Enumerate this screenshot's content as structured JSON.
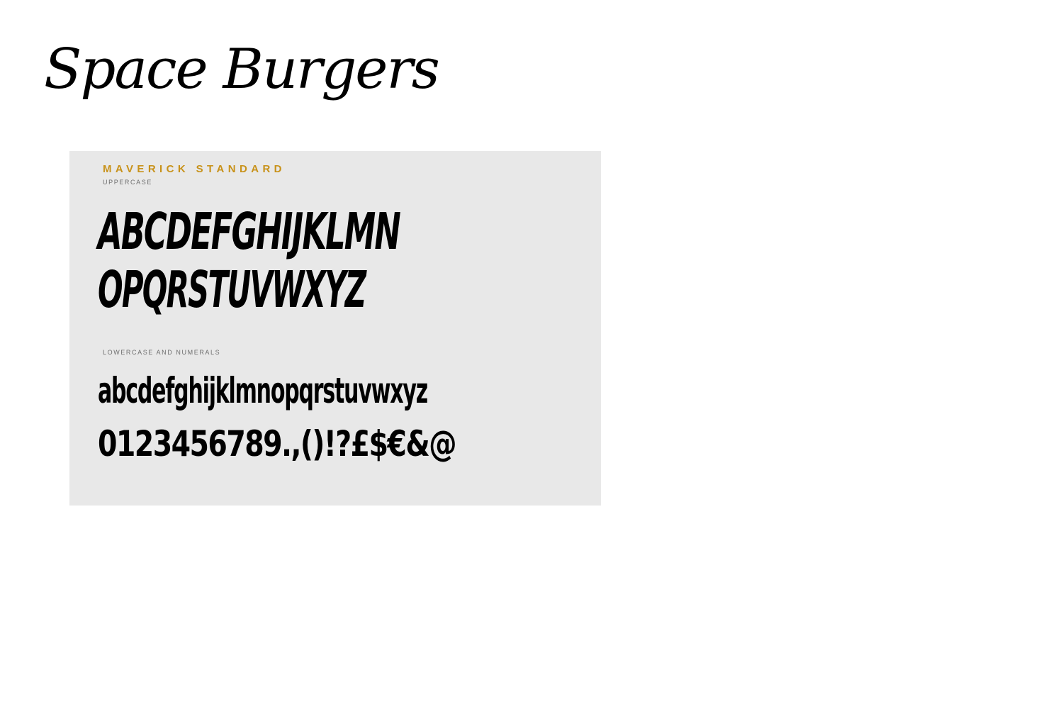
{
  "page": {
    "brand_title": "Space Burgers"
  },
  "specimen": {
    "font_name": "MAVERICK STANDARD",
    "uppercase_label": "UPPERCASE",
    "uppercase_lines": [
      "ABCDEFGHIJKLMN",
      "OPQRSTUVWXYZ"
    ],
    "lowercase_label": "LOWERCASE AND NUMERALS",
    "lowercase_lines": [
      "abcdefghijklmnopqrstuvwxyz",
      "0123456789.,()!?£$€&@"
    ]
  },
  "colors": {
    "page_background": "#ffffff",
    "card_background": "#e8e8e8",
    "accent": "#c8921a",
    "glyph_ink": "#000000",
    "label_gray": "#6e6e6e"
  }
}
